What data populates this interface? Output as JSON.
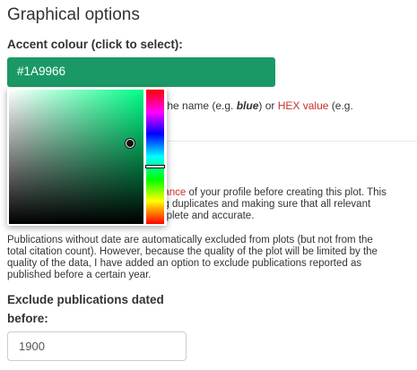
{
  "section": {
    "title": "Graphical options"
  },
  "accent": {
    "label": "Accent colour (click to select):",
    "value": "#1A9966",
    "bg_color": "#1A9966",
    "hint_part1": "the name (e.g. ",
    "hint_em": "blue",
    "hint_part2": ") or ",
    "hint_link": "HEX value",
    "hint_part3": " (e.g."
  },
  "picker": {
    "hue_color": "#00ff87",
    "hue_fraction": 0.57,
    "saturation": 0.9,
    "value": 0.6
  },
  "para1": {
    "link": "nance",
    "line1_rest": " of your profile before creating this plot. This",
    "line2": "ng duplicates and making sure that all relevant",
    "line3": "mplete and accurate."
  },
  "para2": {
    "line1": "Publications without date are automatically excluded from plots (but not from the",
    "line2": "total citation count). However, because the quality of the plot will be limited by the",
    "line3": "quality of the data, I have added an option to exclude publications reported as",
    "line4": "published before a certain year."
  },
  "exclude": {
    "label_line1": "Exclude publications dated",
    "label_line2": "before:",
    "value": "1900"
  }
}
